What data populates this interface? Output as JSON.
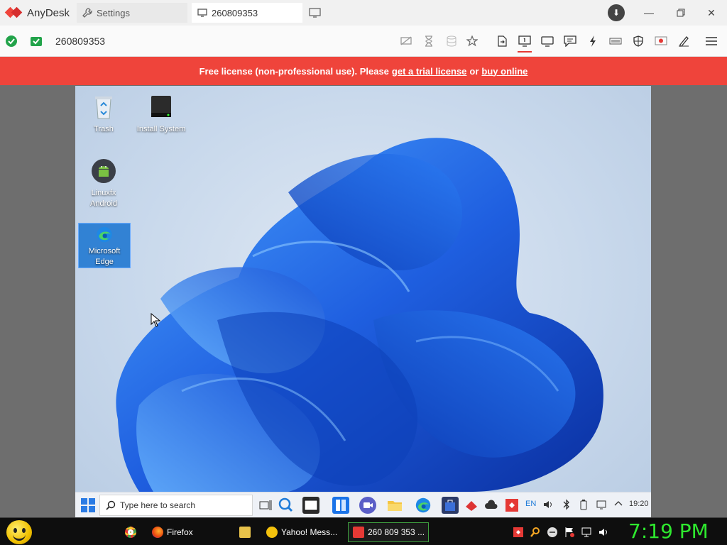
{
  "app": {
    "name": "AnyDesk",
    "tabs": [
      {
        "label": "Settings",
        "icon": "wrench-icon"
      },
      {
        "label": "260809353",
        "icon": "monitor-icon"
      }
    ],
    "window_controls": [
      "download-icon",
      "minimize-icon",
      "restore-icon",
      "close-icon"
    ]
  },
  "toolbar": {
    "address": "260809353",
    "tools": [
      "privacy-icon",
      "hourglass-icon",
      "database-icon",
      "star-icon",
      "session-file-icon",
      "display-1-icon",
      "screen-icon",
      "chat-icon",
      "lightning-icon",
      "keyboard-icon",
      "permissions-icon",
      "record-icon",
      "whiteboard-pen-icon",
      "menu-icon"
    ]
  },
  "banner": {
    "text": "Free license (non-professional use). Please",
    "link1": "get a trial license",
    "middle": "or",
    "link2": "buy online"
  },
  "remote": {
    "desktop_icons": [
      {
        "label": "Trash"
      },
      {
        "label": "Install System"
      },
      {
        "label": "Linuxfx Android"
      },
      {
        "label": "Microsoft Edge"
      }
    ],
    "taskbar": {
      "search_placeholder": "Type here to search",
      "tray_lang": "EN",
      "time": "19:20"
    }
  },
  "host_taskbar": {
    "buttons": [
      {
        "label": ""
      },
      {
        "label": "Firefox"
      },
      {
        "label": ""
      },
      {
        "label": "Yahoo! Mess..."
      },
      {
        "label": "260 809 353 ..."
      }
    ],
    "clock": "7:19 PM"
  },
  "colors": {
    "accent": "#ef443b",
    "clock": "#2ee82e",
    "wallpaper_blue": "#1f5fe0"
  }
}
